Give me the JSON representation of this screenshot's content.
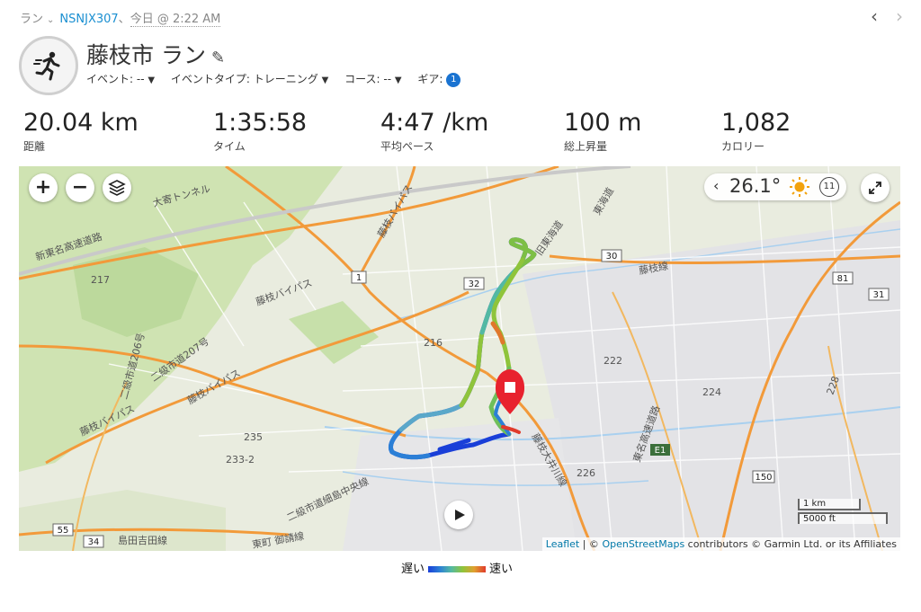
{
  "breadcrumb": {
    "activity_type": "ラン",
    "device": "NSNJX307",
    "separator": "、",
    "time": "今日 @ 2:22 AM"
  },
  "nav": {
    "prev": "‹",
    "next": "›"
  },
  "activity": {
    "title": "藤枝市 ラン",
    "edit_icon": "pencil-icon",
    "meta": {
      "event": "イベント: --",
      "event_type": "イベントタイプ: トレーニング",
      "course": "コース: --",
      "gear_label": "ギア:",
      "gear_count": "1"
    }
  },
  "stats": [
    {
      "value": "20.04 km",
      "label": "距離"
    },
    {
      "value": "1:35:58",
      "label": "タイム"
    },
    {
      "value": "4:47 /km",
      "label": "平均ペース"
    },
    {
      "value": "100 m",
      "label": "総上昇量"
    },
    {
      "value": "1,082",
      "label": "カロリー"
    }
  ],
  "map": {
    "zoom_in": "+",
    "zoom_out": "−",
    "layers_icon": "layers-icon",
    "weather": {
      "temp": "26.1°",
      "condition_icon": "sun-icon",
      "wind": "11"
    },
    "fullscreen_icon": "expand-icon",
    "play_icon": "play-icon",
    "scale": {
      "metric": "1 km",
      "imperial": "5000 ft"
    },
    "attribution": {
      "leaflet": "Leaflet",
      "separator": " | © ",
      "osm": "OpenStreetMaps",
      "rest": " contributors © Garmin Ltd. or its Affiliates"
    },
    "labels": {
      "expressway": "新東名高速道路",
      "tunnel": "大寄トンネル",
      "bypass1": "藤枝バイパス",
      "bypass2": "藤枝バイパス",
      "bypass3": "藤枝バイパス",
      "bypass4": "藤枝バイパス",
      "old_tokaido": "旧東海道",
      "tokaido_line": "東海道",
      "fujieda_line": "藤枝線",
      "tomei": "東名高速道路",
      "oigawa": "藤枝大井川線",
      "ryokuyu": "島田吉田線",
      "shima": "二級市道細島中央線",
      "goza": "東町 御請線",
      "prefroad_206": "二級市道206号",
      "prefroad_207": "二級市道207号",
      "r32": "32",
      "r30": "30",
      "r1": "1",
      "r81": "81",
      "r31": "31",
      "r55": "55",
      "r34": "34",
      "e1": "E1",
      "r150": "150",
      "n222": "222",
      "n224": "224",
      "n216": "216",
      "n235": "235",
      "n226": "226",
      "n233": "233-2",
      "n217": "217",
      "n228": "228"
    },
    "start_marker_icon": "stop-marker-icon"
  },
  "legend": {
    "slow": "遅い",
    "fast": "速い"
  },
  "colors": {
    "accent": "#1a8fd1",
    "badge": "#1a73d1",
    "route_slow": "#1a3fd8",
    "route_fast": "#e03b2b",
    "marker": "#e8222e"
  }
}
